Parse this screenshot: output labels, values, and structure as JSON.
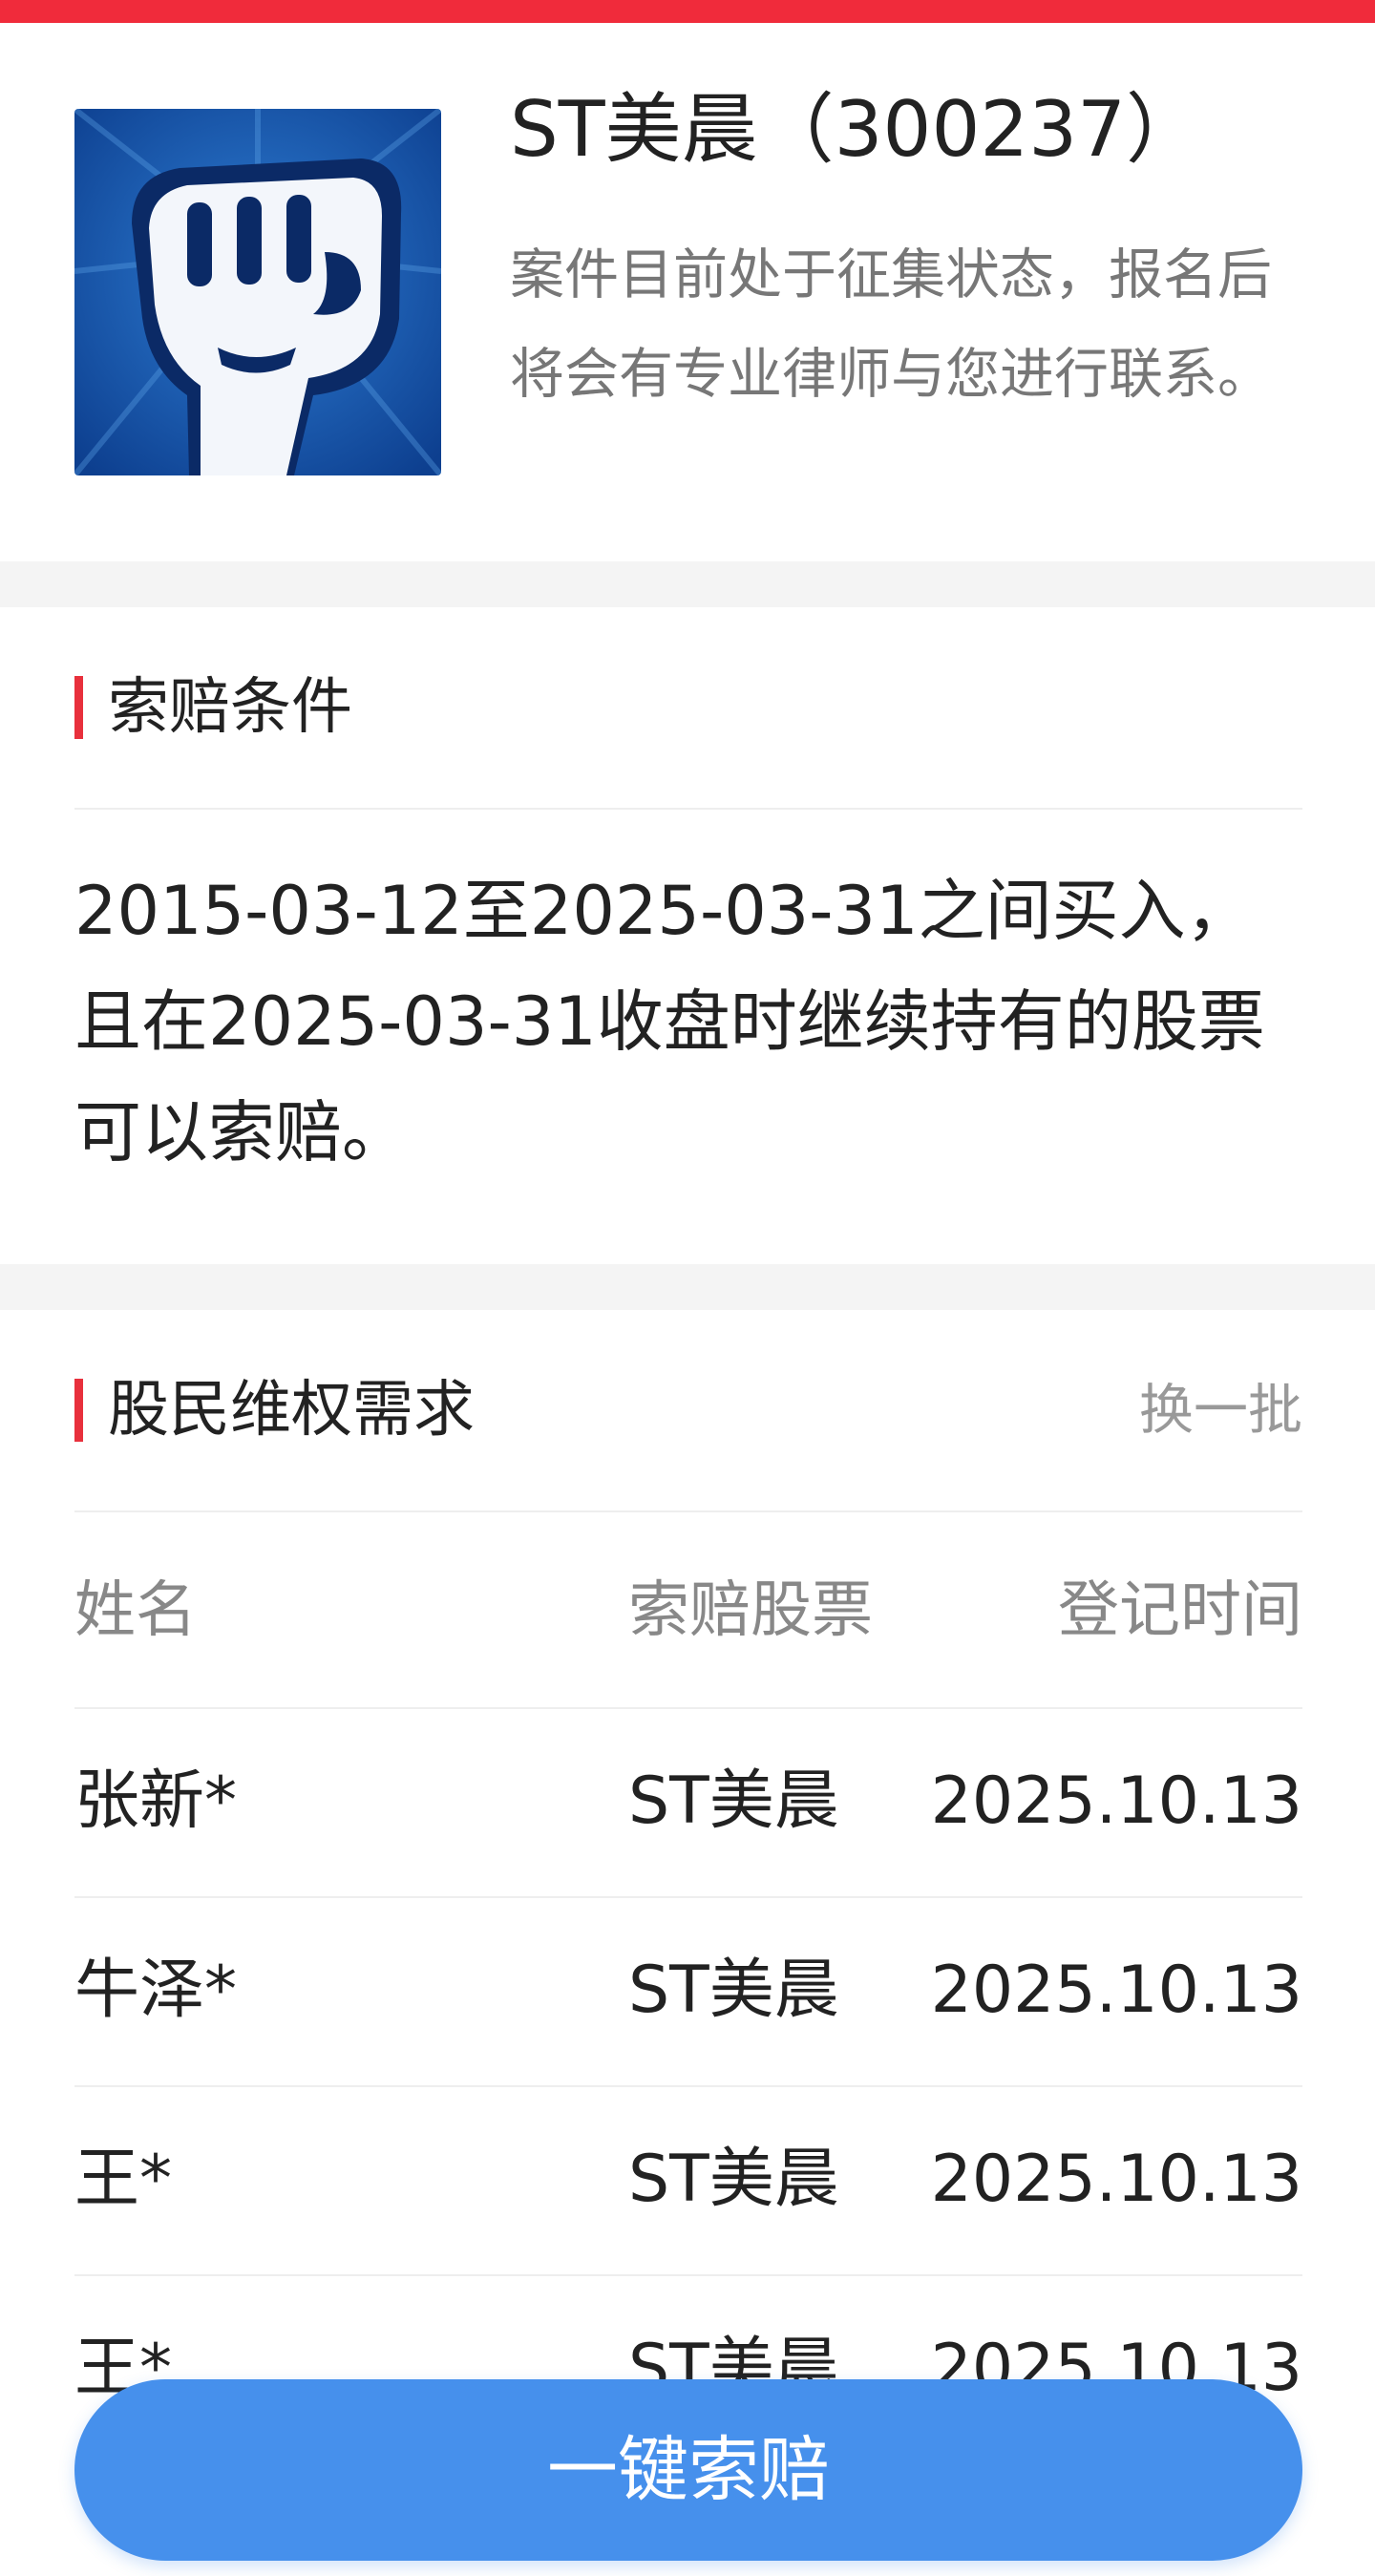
{
  "case": {
    "title": "ST美晨（300237）",
    "description": "案件目前处于征集状态，报名后将会有专业律师与您进行联系。",
    "logo_icon": "raised-fist-icon"
  },
  "conditions": {
    "heading": "索赔条件",
    "text": "2015-03-12至2025-03-31之间买入，且在2025-03-31收盘时继续持有的股票可以索赔。"
  },
  "demands": {
    "heading": "股民维权需求",
    "refresh_label": "换一批",
    "columns": [
      "姓名",
      "索赔股票",
      "登记时间"
    ],
    "rows": [
      {
        "name": "张新*",
        "stock": "ST美晨",
        "date": "2025.10.13"
      },
      {
        "name": "牛泽*",
        "stock": "ST美晨",
        "date": "2025.10.13"
      },
      {
        "name": "王*",
        "stock": "ST美晨",
        "date": "2025.10.13"
      },
      {
        "name": "王*",
        "stock": "ST美晨",
        "date": "2025.10.13"
      }
    ]
  },
  "action": {
    "claim_label": "一键索赔"
  },
  "colors": {
    "accent_red": "#f02b3b",
    "button_blue": "#4690ec"
  }
}
